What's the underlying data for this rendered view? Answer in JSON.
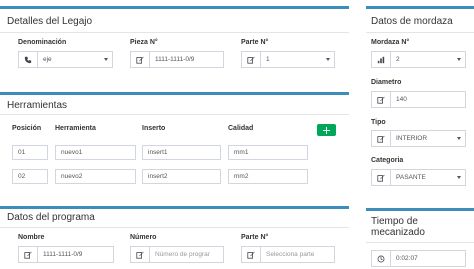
{
  "legajo": {
    "title": "Detalles del Legajo",
    "denominacion_label": "Denominación",
    "denominacion_value": "eje",
    "pieza_label": "Pieza N°",
    "pieza_value": "1111-1111-0/9",
    "parte_label": "Parte N°",
    "parte_value": "1"
  },
  "herramientas": {
    "title": "Herramientas",
    "columns": [
      "Posición",
      "Herramienta",
      "Inserto",
      "Calidad"
    ],
    "rows": [
      {
        "posicion": "01",
        "herramienta": "nuevo1",
        "inserto": "insert1",
        "calidad": "mm1"
      },
      {
        "posicion": "02",
        "herramienta": "nuevo2",
        "inserto": "insert2",
        "calidad": "mm2"
      }
    ]
  },
  "programa": {
    "title": "Datos del programa",
    "nombre_label": "Nombre",
    "nombre_value": "1111-1111-0/9",
    "numero_label": "Número",
    "numero_placeholder": "Número de prograr",
    "parte_label": "Parte N°",
    "parte_placeholder": "Selecciona parte"
  },
  "mordaza": {
    "title": "Datos de mordaza",
    "mordaza_label": "Mordaza N°",
    "mordaza_value": "2",
    "diametro_label": "Diametro",
    "diametro_value": "140",
    "tipo_label": "Tipo",
    "tipo_value": "INTERIOR",
    "categoria_label": "Categoria",
    "categoria_value": "PASANTE"
  },
  "tiempo": {
    "title": "Tiempo de mecanizado",
    "value": "0:02:07"
  },
  "colors": {
    "accent": "#3c8dbc",
    "add_button": "#00a65a"
  }
}
